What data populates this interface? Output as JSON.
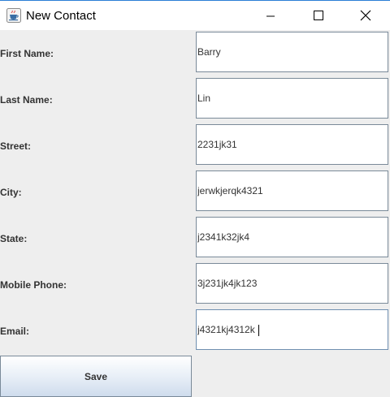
{
  "window": {
    "title": "New Contact",
    "app_icon": "java-cup-icon"
  },
  "form": {
    "fields": [
      {
        "label": "First Name:",
        "value": "Barry"
      },
      {
        "label": "Last Name:",
        "value": "Lin"
      },
      {
        "label": "Street:",
        "value": "2231jk31"
      },
      {
        "label": "City:",
        "value": "jerwkjerqk4321"
      },
      {
        "label": "State:",
        "value": "j2341k32jk4"
      },
      {
        "label": "Mobile Phone:",
        "value": "3j231jk4jk123"
      },
      {
        "label": "Email:",
        "value": "j4321kj4312k"
      }
    ],
    "save_label": "Save"
  },
  "colors": {
    "titlebar_accent": "#2b7fd6",
    "panel_background": "#eeeeee",
    "field_border": "#7a8a99",
    "button_gradient_bottom": "#cfdced"
  }
}
